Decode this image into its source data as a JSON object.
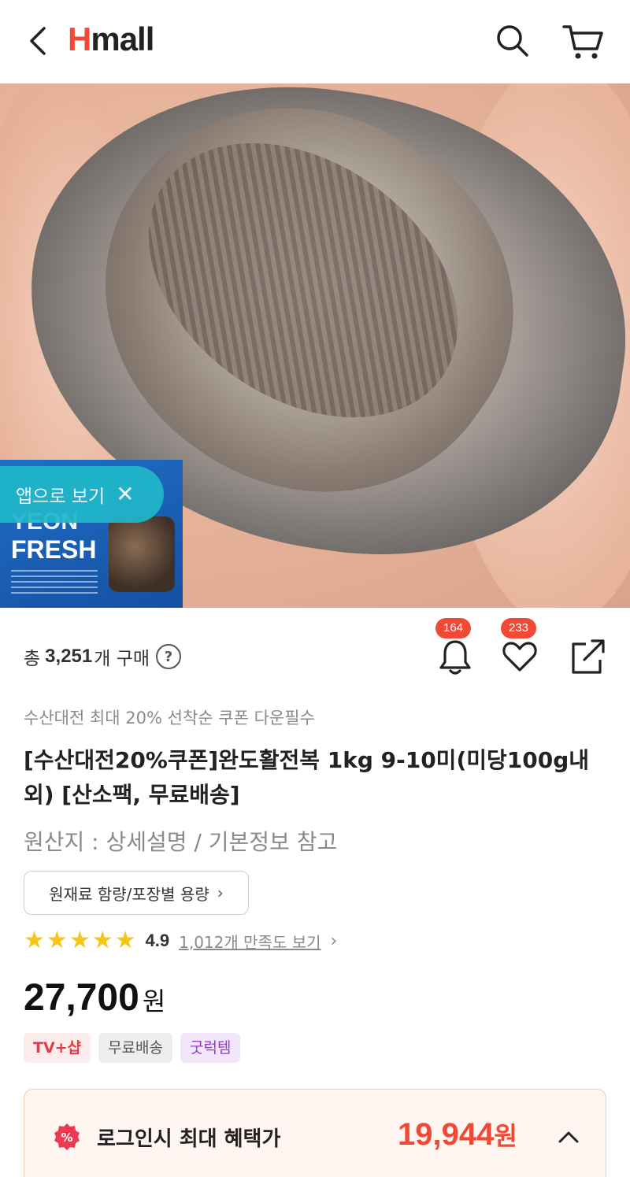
{
  "header": {
    "logo_h": "H",
    "logo_rest": "mall",
    "brand_color": "#f04a36"
  },
  "hero": {
    "app_banner_label": "앱으로 보기",
    "app_banner_close": "✕",
    "pack_line1": "YEON",
    "pack_line2": "FRESH"
  },
  "purchase": {
    "prefix": "총",
    "count": "3,251",
    "suffix": "개 구매",
    "help": "?"
  },
  "actions": {
    "alarm_count": "164",
    "like_count": "233"
  },
  "product": {
    "promo": "수산대전 최대 20% 선착순 쿠폰 다운필수",
    "title": "[수산대전20%쿠폰]완도활전복 1kg 9-10미(미당100g내외) [산소팩, 무료배송]",
    "origin": "원산지 : 상세설명 / 기본정보 참고",
    "spec_button": "원재료 함량/포장별 용량",
    "spec_chevron": "›"
  },
  "rating": {
    "score": "4.9",
    "stars_filled": 5,
    "review_link": "1,012개 만족도 보기",
    "chevron": "›"
  },
  "price": {
    "value": "27,700",
    "unit": "원"
  },
  "tags": [
    "TV+샵",
    "무료배송",
    "굿럭템"
  ],
  "benefit": {
    "label": "로그인시 최대 혜택가",
    "price": "19,944",
    "unit": "원",
    "accent": "#f04a36"
  }
}
